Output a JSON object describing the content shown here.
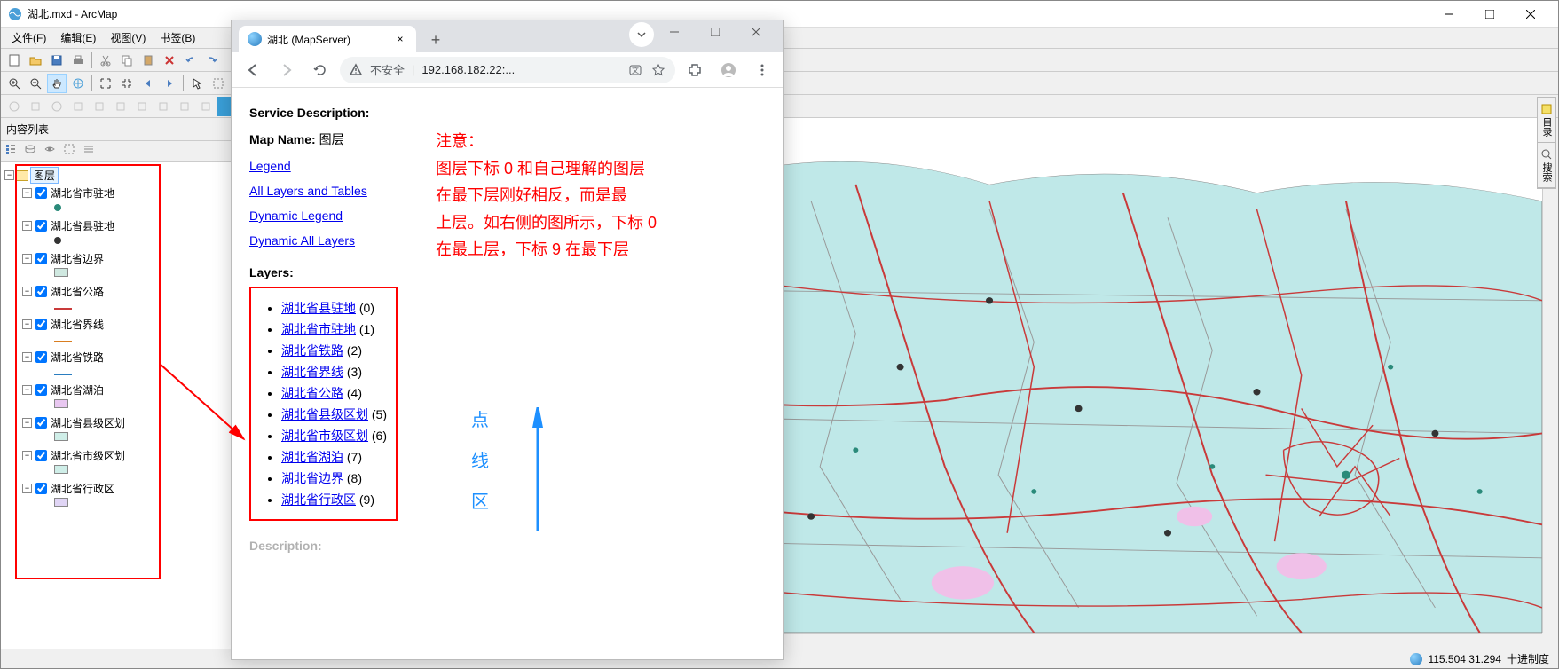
{
  "arcmap": {
    "title": "湖北.mxd - ArcMap",
    "menus": [
      "文件(F)",
      "编辑(E)",
      "视图(V)",
      "书签(B)"
    ],
    "toc_title": "内容列表",
    "root_layer": "图层",
    "layers": [
      {
        "name": "湖北省市驻地",
        "type": "point",
        "color": "#2a8a7a"
      },
      {
        "name": "湖北省县驻地",
        "type": "point",
        "color": "#333"
      },
      {
        "name": "湖北省边界",
        "type": "poly",
        "color": "#cfe8e0"
      },
      {
        "name": "湖北省公路",
        "type": "line",
        "color": "#c93a3a"
      },
      {
        "name": "湖北省界线",
        "type": "line",
        "color": "#d97d20"
      },
      {
        "name": "湖北省铁路",
        "type": "line",
        "color": "#2a7dc0"
      },
      {
        "name": "湖北省湖泊",
        "type": "poly",
        "color": "#e8c7f0"
      },
      {
        "name": "湖北省县级区划",
        "type": "poly",
        "color": "#cfeee8"
      },
      {
        "name": "湖北省市级区划",
        "type": "poly",
        "color": "#cfeee8"
      },
      {
        "name": "湖北省行政区",
        "type": "poly",
        "color": "#e0d5f5"
      }
    ],
    "status": {
      "coords": "115.504  31.294",
      "unit": "十进制度"
    },
    "dock": {
      "catalog": "目录",
      "search": "搜索"
    }
  },
  "browser": {
    "tab_title": "湖北 (MapServer)",
    "url_label": "不安全",
    "url": "192.168.182.22:...",
    "service_desc_label": "Service Description:",
    "map_name_label": "Map Name:",
    "map_name_value": "图层",
    "links": {
      "legend": "Legend",
      "all_layers": "All Layers and Tables",
      "dyn_legend": "Dynamic Legend",
      "dyn_all": "Dynamic All Layers"
    },
    "layers_label": "Layers:",
    "layers": [
      {
        "name": "湖北省县驻地",
        "id": "(0)"
      },
      {
        "name": "湖北省市驻地",
        "id": "(1)"
      },
      {
        "name": "湖北省铁路",
        "id": "(2)"
      },
      {
        "name": "湖北省界线",
        "id": "(3)"
      },
      {
        "name": "湖北省公路",
        "id": "(4)"
      },
      {
        "name": "湖北省县级区划",
        "id": "(5)"
      },
      {
        "name": "湖北省市级区划",
        "id": "(6)"
      },
      {
        "name": "湖北省湖泊",
        "id": "(7)"
      },
      {
        "name": "湖北省边界",
        "id": "(8)"
      },
      {
        "name": "湖北省行政区",
        "id": "(9)"
      }
    ],
    "desc_label": "Description:"
  },
  "annotations": {
    "note_title": "注意：",
    "note_line1": "图层下标 0 和自己理解的图层",
    "note_line2": "在最下层刚好相反，而是最",
    "note_line3": "上层。如右侧的图所示，下标 0",
    "note_line4": "在最上层，下标 9 在最下层",
    "blue1": "点",
    "blue2": "线",
    "blue3": "区"
  }
}
